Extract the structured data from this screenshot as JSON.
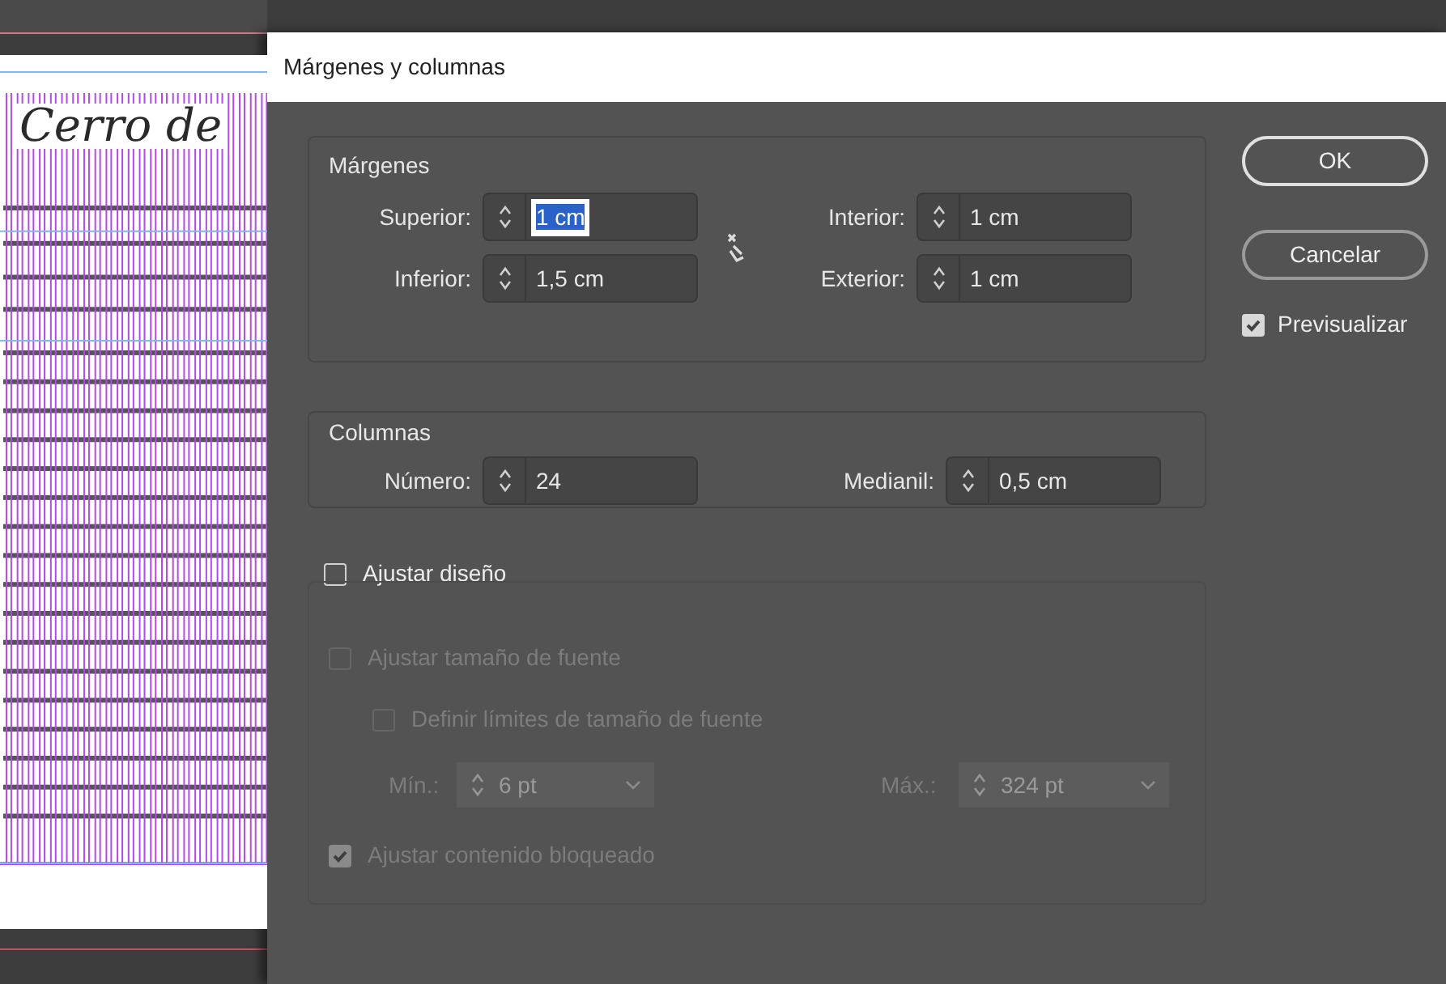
{
  "document": {
    "title": "Cerro de"
  },
  "dialog": {
    "title": "Márgenes y columnas",
    "margins": {
      "label": "Márgenes",
      "linked": false,
      "fields": [
        {
          "label": "Superior:",
          "value": "1 cm",
          "selected": true
        },
        {
          "label": "Inferior:",
          "value": "1,5 cm",
          "selected": false
        },
        {
          "label": "Interior:",
          "value": "1 cm",
          "selected": false
        },
        {
          "label": "Exterior:",
          "value": "1 cm",
          "selected": false
        }
      ]
    },
    "columns": {
      "label": "Columnas",
      "fields": [
        {
          "label": "Número:",
          "value": "24"
        },
        {
          "label": "Medianil:",
          "value": "0,5 cm"
        }
      ]
    },
    "layout": {
      "label": "Ajustar diseño",
      "checked": false,
      "options": [
        {
          "kind": "checkbox",
          "label": "Ajustar tamaño de fuente",
          "checked": false,
          "disabled": true,
          "children": [
            {
              "kind": "checkbox",
              "label": "Definir límites de tamaño de fuente",
              "checked": false,
              "disabled": true
            },
            {
              "kind": "limits",
              "disabled": true,
              "min": {
                "label": "Mín.:",
                "value": "6 pt"
              },
              "max": {
                "label": "Máx.:",
                "value": "324 pt"
              }
            }
          ]
        },
        {
          "kind": "checkbox",
          "label": "Ajustar contenido bloqueado",
          "checked": true,
          "disabled": true
        }
      ]
    },
    "buttons": [
      {
        "label": "OK",
        "default": true
      },
      {
        "label": "Cancelar",
        "default": false
      }
    ],
    "preview": {
      "label": "Previsualizar",
      "checked": true
    }
  }
}
